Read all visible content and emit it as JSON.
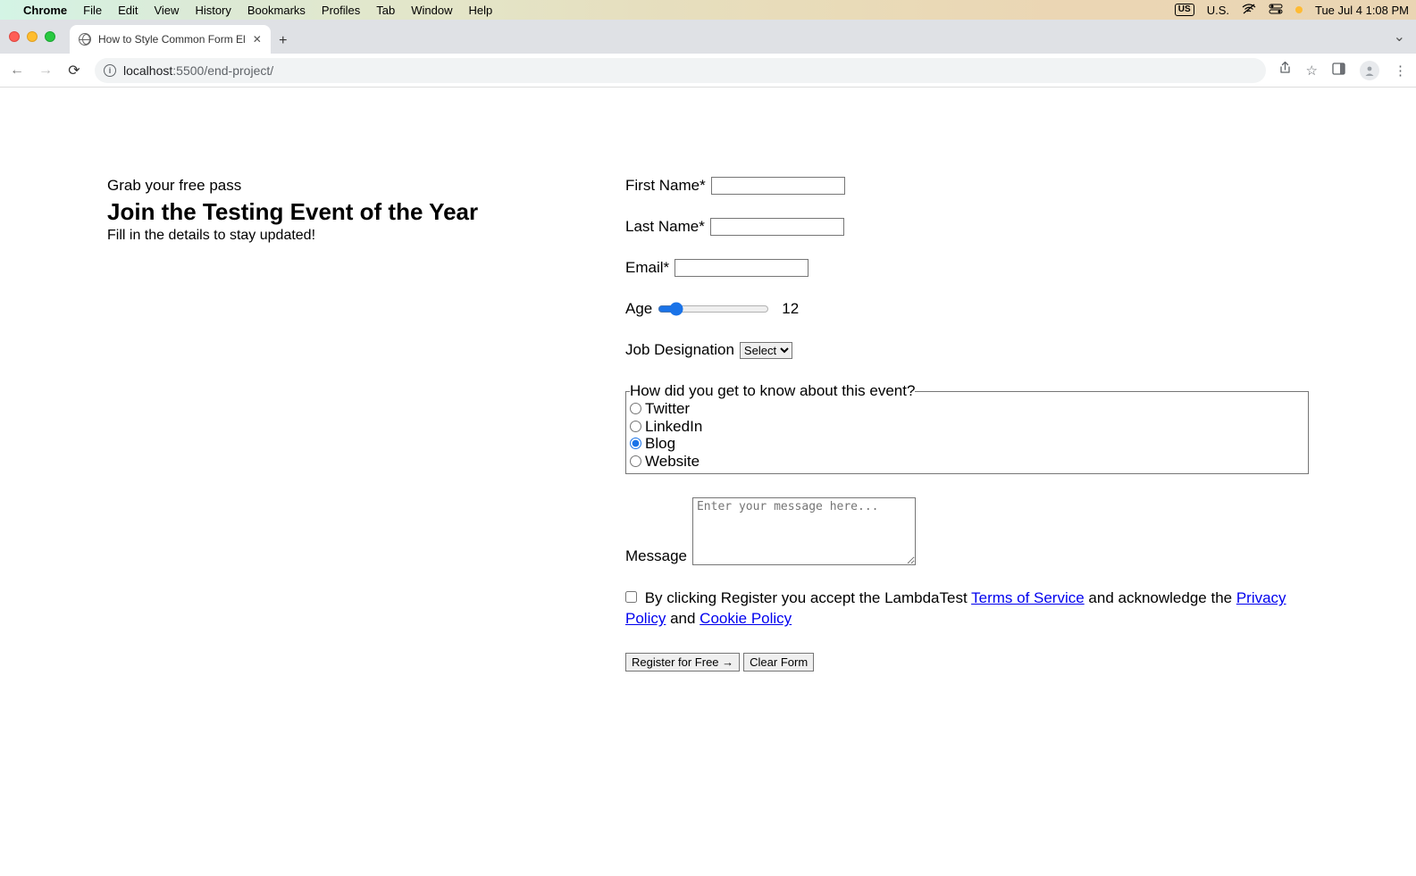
{
  "menubar": {
    "app_name": "Chrome",
    "items": [
      "File",
      "Edit",
      "View",
      "History",
      "Bookmarks",
      "Profiles",
      "Tab",
      "Window",
      "Help"
    ],
    "input_source_box": "US",
    "input_source": "U.S.",
    "datetime": "Tue Jul 4  1:08 PM"
  },
  "browser": {
    "tab_title": "How to Style Common Form El",
    "url_host": "localhost",
    "url_port": ":5500",
    "url_path": "/end-project/"
  },
  "page": {
    "supertitle": "Grab your free pass",
    "title": "Join the Testing Event of the Year",
    "subtitle": "Fill in the details to stay updated!",
    "form": {
      "first_name_label": "First Name",
      "last_name_label": "Last Name",
      "email_label": "Email",
      "required_marker": "*",
      "age_label": "Age",
      "age_value": "12",
      "job_label": "Job Designation",
      "job_selected": "Select",
      "fieldset_legend": "How did you get to know about this event?",
      "radio_options": [
        "Twitter",
        "LinkedIn",
        "Blog",
        "Website"
      ],
      "radio_selected_index": 2,
      "message_label": "Message",
      "message_placeholder": "Enter your message here...",
      "consent_prefix": " By clicking Register you accept the LambdaTest ",
      "tos_link": "Terms of Service",
      "consent_mid1": " and acknowledge the ",
      "privacy_link": "Privacy Policy",
      "consent_mid2": " and ",
      "cookie_link": "Cookie Policy",
      "register_btn": "Register for Free →",
      "clear_btn": "Clear Form"
    }
  }
}
